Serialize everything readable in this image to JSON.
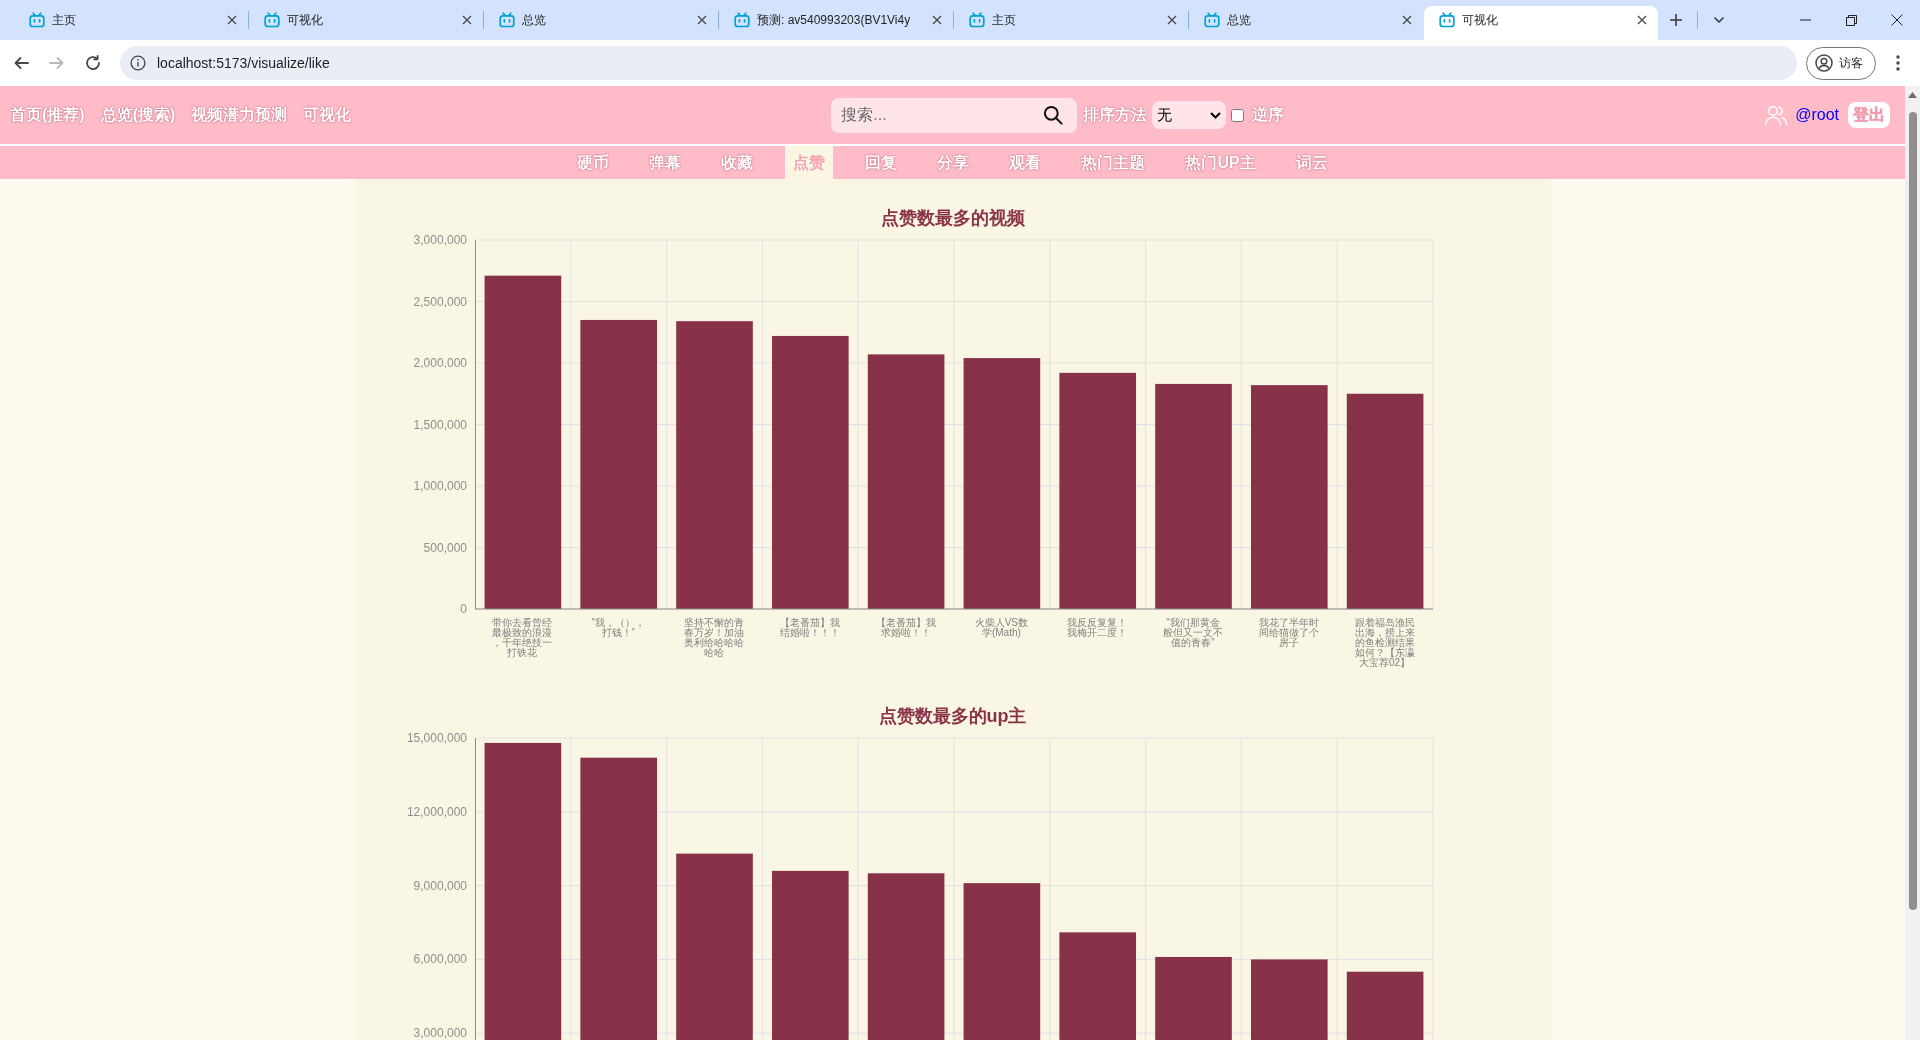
{
  "browser": {
    "tabs": [
      {
        "title": "主页",
        "selected": false
      },
      {
        "title": "可视化",
        "selected": false
      },
      {
        "title": "总览",
        "selected": false
      },
      {
        "title": "预测: av540993203(BV1Vi4y",
        "selected": false
      },
      {
        "title": "主页",
        "selected": false
      },
      {
        "title": "总览",
        "selected": false
      },
      {
        "title": "可视化",
        "selected": true
      }
    ],
    "nav_buttons": [
      {
        "kind": "back",
        "disabled": false
      },
      {
        "kind": "forward",
        "disabled": true
      },
      {
        "kind": "reload",
        "disabled": false
      }
    ],
    "address": "localhost:5173/visualize/like",
    "profile": "访客"
  },
  "header": {
    "links": [
      "首页(推荐)",
      "总览(搜索)",
      "视频潜力预测",
      "可视化"
    ],
    "search": {
      "placeholder": "搜索..."
    },
    "sort": {
      "label": "排序方法",
      "value": "无"
    },
    "reverse": {
      "label": "逆序",
      "checked": false
    },
    "user": "@root",
    "logout": "登出"
  },
  "subnav": [
    {
      "label": "硬币",
      "selected": false
    },
    {
      "label": "弹幕",
      "selected": false
    },
    {
      "label": "收藏",
      "selected": false
    },
    {
      "label": "点赞",
      "selected": true
    },
    {
      "label": "回复",
      "selected": false
    },
    {
      "label": "分享",
      "selected": false
    },
    {
      "label": "观看",
      "selected": false
    },
    {
      "label": "热门主题",
      "selected": false
    },
    {
      "label": "热门UP主",
      "selected": false
    },
    {
      "label": "词云",
      "selected": false
    }
  ],
  "charts": [
    {
      "chart_data": {
        "type": "bar",
        "title": "点赞数最多的视频",
        "categories": [
          "带你去看曾经最极致的浪漫，千年绝技一打铁花",
          "“我，（），打钱！”",
          "坚持不懈的青春万岁！加油奥利给哈哈哈哈哈",
          "【老番茄】我结婚啦！！！",
          "【老番茄】我求婚啦！！",
          "火柴人VS数学(Math)",
          "我反反复复！我梅开二度！",
          "“我们那黄金般但又一文不值的青春”",
          "我花了半年时间给猫做了个房子",
          "跟着福岛渔民出海，捞上来的鱼检测结果如何？【东瀛大宝荐02】"
        ],
        "values": [
          2710000,
          2350000,
          2340000,
          2220000,
          2070000,
          2040000,
          1920000,
          1830000,
          1820000,
          1750000
        ],
        "ylim": [
          0,
          3000000
        ],
        "yticks": [
          {
            "value": 0,
            "label": "0"
          },
          {
            "value": 500000,
            "label": "500,000"
          },
          {
            "value": 1000000,
            "label": "1,000,000"
          },
          {
            "value": 1500000,
            "label": "1,500,000"
          },
          {
            "value": 2000000,
            "label": "2,000,000"
          },
          {
            "value": 2500000,
            "label": "2,500,000"
          },
          {
            "value": 3000000,
            "label": "3,000,000"
          }
        ],
        "grid": true
      }
    },
    {
      "chart_data": {
        "type": "bar",
        "title": "点赞数最多的up主",
        "values": [
          14800000,
          14200000,
          10300000,
          9600000,
          9500000,
          9100000,
          7100000,
          6100000,
          6000000,
          5500000
        ],
        "ylim": [
          0,
          15000000
        ],
        "yticks": [
          {
            "value": 3000000,
            "label": "3,000,000"
          },
          {
            "value": 6000000,
            "label": "6,000,000"
          },
          {
            "value": 9000000,
            "label": "9,000,000"
          },
          {
            "value": 12000000,
            "label": "12,000,000"
          },
          {
            "value": 15000000,
            "label": "15,000,000"
          }
        ],
        "grid": true
      }
    }
  ]
}
